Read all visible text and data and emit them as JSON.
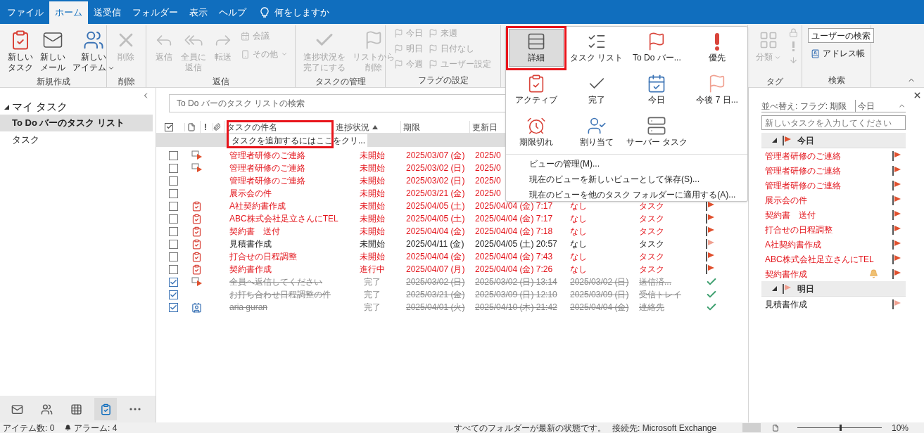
{
  "menu_tabs": [
    {
      "label": "ファイル",
      "selected": false
    },
    {
      "label": "ホーム",
      "selected": true
    },
    {
      "label": "送受信",
      "selected": false
    },
    {
      "label": "フォルダー",
      "selected": false
    },
    {
      "label": "表示",
      "selected": false
    },
    {
      "label": "ヘルプ",
      "selected": false
    }
  ],
  "tell_me": "何をしますか",
  "ribbon": {
    "groups": [
      {
        "title": "新規作成",
        "items": [
          {
            "kind": "large",
            "lines": [
              "新しい",
              "タスク"
            ],
            "disabled": false,
            "dropdown": false
          },
          {
            "kind": "large",
            "lines": [
              "新しい",
              "メール"
            ],
            "disabled": false,
            "dropdown": false
          },
          {
            "kind": "large",
            "lines": [
              "新しい",
              "アイテム"
            ],
            "disabled": false,
            "dropdown": true
          }
        ]
      },
      {
        "title": "削除",
        "items": [
          {
            "kind": "large",
            "lines": [
              "削除"
            ],
            "disabled": true,
            "dropdown": false
          }
        ]
      },
      {
        "title": "返信",
        "items": [
          {
            "kind": "large",
            "lines": [
              "返信"
            ],
            "disabled": true,
            "dropdown": false
          },
          {
            "kind": "large",
            "lines": [
              "全員に",
              "返信"
            ],
            "disabled": true,
            "dropdown": false
          },
          {
            "kind": "large",
            "lines": [
              "転送"
            ],
            "disabled": true,
            "dropdown": false
          },
          {
            "kind": "small",
            "lines": [
              "会議"
            ],
            "disabled": true,
            "dropdown": false
          },
          {
            "kind": "small",
            "lines": [
              "その他"
            ],
            "disabled": true,
            "dropdown": true
          }
        ]
      },
      {
        "title": "タスクの管理",
        "items": [
          {
            "kind": "large",
            "lines": [
              "進捗状況を",
              "完了にする"
            ],
            "disabled": true,
            "dropdown": false
          },
          {
            "kind": "large",
            "lines": [
              "リストから",
              "削除"
            ],
            "disabled": true,
            "dropdown": false
          }
        ]
      },
      {
        "title": "フラグの設定",
        "items": [
          {
            "kind": "small",
            "lines": [
              "今日"
            ],
            "disabled": true,
            "dropdown": false
          },
          {
            "kind": "small",
            "lines": [
              "明日"
            ],
            "disabled": true,
            "dropdown": false
          },
          {
            "kind": "small",
            "lines": [
              "今週"
            ],
            "disabled": true,
            "dropdown": false
          },
          {
            "kind": "small",
            "lines": [
              "来週"
            ],
            "disabled": true,
            "dropdown": false
          },
          {
            "kind": "small",
            "lines": [
              "日付なし"
            ],
            "disabled": true,
            "dropdown": false
          },
          {
            "kind": "small",
            "lines": [
              "ユーザー設定"
            ],
            "disabled": true,
            "dropdown": false
          }
        ]
      },
      {
        "title": "タグ",
        "items": [
          {
            "kind": "large",
            "lines": [
              "分類"
            ],
            "disabled": true,
            "dropdown": true
          }
        ]
      },
      {
        "title": "検索",
        "items": [
          {
            "kind": "field",
            "lines": [
              "ユーザーの検索"
            ],
            "disabled": false,
            "dropdown": false
          },
          {
            "kind": "small",
            "lines": [
              "アドレス帳"
            ],
            "disabled": false,
            "dropdown": false
          }
        ]
      }
    ]
  },
  "view_menu": {
    "views": [
      {
        "label": "詳細",
        "selected": true
      },
      {
        "label": "タスク リスト",
        "selected": false
      },
      {
        "label": "To Do バー...",
        "selected": false
      },
      {
        "label": "優先",
        "selected": false
      },
      {
        "label": "アクティブ",
        "selected": false
      },
      {
        "label": "完了",
        "selected": false
      },
      {
        "label": "今日",
        "selected": false
      },
      {
        "label": "今後 7 日...",
        "selected": false
      },
      {
        "label": "期限切れ",
        "selected": false
      },
      {
        "label": "割り当て",
        "selected": false
      },
      {
        "label": "サーバー タスク",
        "selected": false
      }
    ],
    "commands": [
      "ビューの管理(M)...",
      "現在のビューを新しいビューとして保存(S)...",
      "現在のビューを他のタスク フォルダーに適用する(A)..."
    ]
  },
  "folder_pane": {
    "title": "マイ タスク",
    "expanded": true,
    "items": [
      {
        "label": "To Do バーのタスク リスト",
        "selected": true
      },
      {
        "label": "タスク",
        "selected": false
      }
    ]
  },
  "nav_icons": [
    {
      "selected": false
    },
    {
      "selected": false
    },
    {
      "selected": false
    },
    {
      "selected": true
    },
    {
      "selected": false
    }
  ],
  "task_list": {
    "search_placeholder": "To Do バーのタスク リストの検索",
    "columns": [
      "!",
      "タスクの件名",
      "進捗状況",
      "期限",
      "更新日"
    ],
    "sort_ascending": true,
    "add_task_prompt": "タスクを追加するにはここをクリ...",
    "rows": [
      {
        "checked": false,
        "kind": "flagged-mail",
        "overdue": true,
        "subject": "管理者研修のご連絡",
        "status": "未開始",
        "due": "2025/03/07 (金)",
        "modified": "2025/0"
      },
      {
        "checked": false,
        "kind": "flagged-mail",
        "overdue": true,
        "subject": "管理者研修のご連絡",
        "status": "未開始",
        "due": "2025/03/02 (日)",
        "modified": "2025/0"
      },
      {
        "checked": false,
        "kind": "plain",
        "overdue": true,
        "subject": "管理者研修のご連絡",
        "status": "未開始",
        "due": "2025/03/02 (日)",
        "modified": "2025/0"
      },
      {
        "checked": false,
        "kind": "plain",
        "overdue": true,
        "subject": "展示会の件",
        "status": "未開始",
        "due": "2025/03/21 (金)",
        "modified": "2025/0"
      },
      {
        "checked": false,
        "kind": "task",
        "overdue": true,
        "subject": "A社契約書作成",
        "status": "未開始",
        "due": "2025/04/05 (土)",
        "modified": "2025/04/04 (金) 7:17",
        "column_8": "なし",
        "folder": "タスク",
        "color": "#e0502e"
      },
      {
        "checked": false,
        "kind": "task",
        "overdue": true,
        "subject": "ABC株式会社足立さんにTEL",
        "status": "未開始",
        "due": "2025/04/05 (土)",
        "modified": "2025/04/04 (金) 7:17",
        "column_8": "なし",
        "folder": "タスク",
        "color": "#e0502e"
      },
      {
        "checked": false,
        "kind": "task",
        "overdue": true,
        "subject": "契約書　送付",
        "status": "未開始",
        "due": "2025/04/04 (金)",
        "modified": "2025/04/04 (金) 7:18",
        "column_8": "なし",
        "folder": "タスク",
        "color": "#e0502e"
      },
      {
        "checked": false,
        "kind": "task",
        "overdue": false,
        "subject": "見積書作成",
        "status": "未開始",
        "due": "2025/04/11 (金)",
        "modified": "2025/04/05 (土) 20:57",
        "column_8": "なし",
        "folder": "タスク",
        "color": "#f0a090"
      },
      {
        "checked": false,
        "kind": "task",
        "overdue": true,
        "subject": "打合せの日程調整",
        "status": "未開始",
        "due": "2025/04/04 (金)",
        "modified": "2025/04/04 (金) 7:43",
        "column_8": "なし",
        "folder": "タスク",
        "color": "#e0502e"
      },
      {
        "checked": false,
        "kind": "task",
        "overdue": true,
        "subject": "契約書作成",
        "status": "進行中",
        "due": "2025/04/07 (月)",
        "modified": "2025/04/04 (金) 7:26",
        "column_8": "なし",
        "folder": "タスク",
        "color": "#e0502e"
      },
      {
        "checked": true,
        "kind": "flagged-mail",
        "subject": "全員へ返信してください",
        "status": "完了",
        "due": "2025/03/02 (日)",
        "modified": "2025/03/02 (日) 13:14",
        "column_8": "2025/03/02 (日)",
        "folder": "送信済..."
      },
      {
        "checked": true,
        "kind": "plain",
        "subject": "お打ち合わせ日程調整の件",
        "status": "完了",
        "due": "2025/03/21 (金)",
        "modified": "2025/03/09 (日) 12:10",
        "column_8": "2025/03/09 (日)",
        "folder": "受信トレイ"
      },
      {
        "checked": true,
        "kind": "contact",
        "subject": "aria guran",
        "status": "完了",
        "due": "2025/04/01 (火)",
        "modified": "2025/04/10 (木) 21:42",
        "column_8": "2025/04/04 (金)",
        "folder": "連絡先"
      }
    ]
  },
  "todo_bar": {
    "sort_label": "並べ替え: フラグ: 期限",
    "sort_value": "今日",
    "new_task_placeholder": "新しいタスクを入力してください",
    "groups": [
      {
        "title": "今日",
        "expanded": true,
        "color": "#e0502e",
        "items": [
          {
            "subject": "管理者研修のご連絡",
            "overdue": true,
            "reminder": false,
            "color": "#e0502e"
          },
          {
            "subject": "管理者研修のご連絡",
            "overdue": true,
            "reminder": false,
            "color": "#e0502e"
          },
          {
            "subject": "管理者研修のご連絡",
            "overdue": true,
            "reminder": false,
            "color": "#e0502e"
          },
          {
            "subject": "展示会の件",
            "overdue": true,
            "reminder": false,
            "color": "#e0502e"
          },
          {
            "subject": "契約書　送付",
            "overdue": true,
            "reminder": false,
            "color": "#e0502e"
          },
          {
            "subject": "打合せの日程調整",
            "overdue": true,
            "reminder": false,
            "color": "#e0502e"
          },
          {
            "subject": "A社契約書作成",
            "overdue": true,
            "reminder": false,
            "color": "#e0502e"
          },
          {
            "subject": "ABC株式会社足立さんにTEL",
            "overdue": true,
            "reminder": false,
            "color": "#e0502e"
          },
          {
            "subject": "契約書作成",
            "overdue": true,
            "reminder": true,
            "color": "#e0502e"
          }
        ]
      },
      {
        "title": "明日",
        "expanded": true,
        "color": "#f0a090",
        "items": [
          {
            "subject": "見積書作成",
            "overdue": false,
            "reminder": false,
            "color": "#f0a090"
          }
        ]
      }
    ]
  },
  "status_bar": {
    "item_count": "アイテム数: 0",
    "alarms": "アラーム: 4",
    "sync": "すべてのフォルダーが最新の状態です。",
    "connection": "接続先: Microsoft Exchange",
    "zoom_slider": {
      "level": 0.5
    },
    "zoom": "10%"
  }
}
